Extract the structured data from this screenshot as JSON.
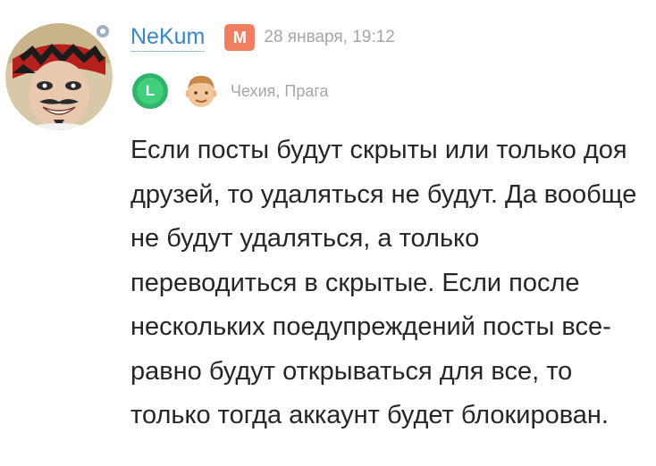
{
  "post": {
    "author": {
      "username": "NeKum",
      "gender_badge": "М",
      "level_badge": "L",
      "location": "Чехия, Прага",
      "face_icon": "face-emoji-icon"
    },
    "timestamp": "28 января, 19:12",
    "body": "Если посты будут скрыты или только доя друзей, то удаляться не будут. Да вообще не будут удаляться, а только переводиться в скрытые. Если после нескольких поедупреждений посты все-равно будут открываться для все, то только тогда аккаунт будет блокирован.",
    "colors": {
      "username": "#3a86c8",
      "gender_badge": "#f07f62",
      "level_badge": "#2fb36a",
      "meta_text": "#a6a6a6",
      "body_text": "#262626"
    }
  }
}
